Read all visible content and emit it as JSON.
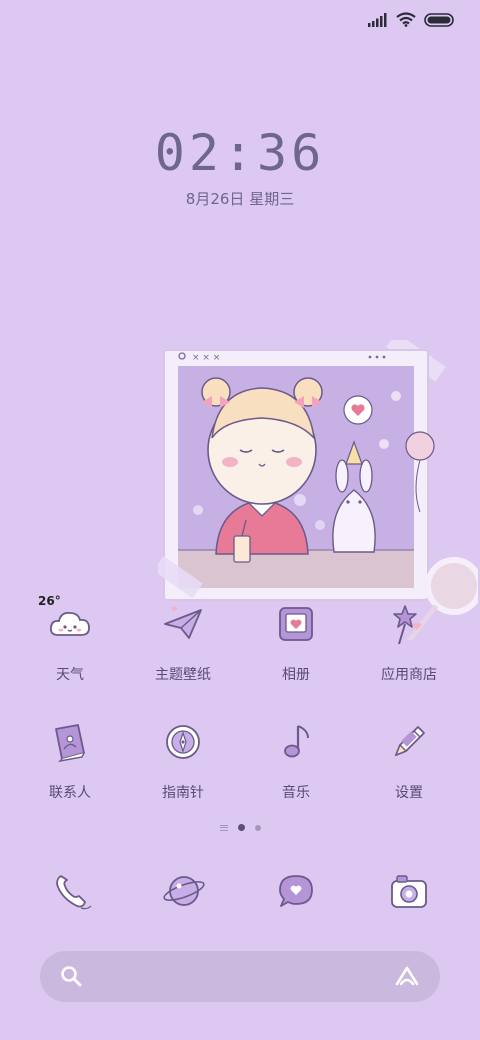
{
  "status_bar": {
    "icons": [
      "signal-icon",
      "wifi-icon",
      "battery-icon"
    ]
  },
  "lock_clock": {
    "time": "02:36",
    "date": "8月26日 星期三"
  },
  "widget": {
    "photo_frame_marks": "○ × × ×",
    "colors": {
      "frame": "#f4eefb",
      "photo_bg": "#c9b3e6",
      "table": "#d9c2cc"
    }
  },
  "weather": {
    "temperature": "26°"
  },
  "apps": {
    "row1": [
      {
        "label": "天气",
        "icon": "cloud-icon"
      },
      {
        "label": "主题壁纸",
        "icon": "paper-plane-icon"
      },
      {
        "label": "相册",
        "icon": "photo-album-icon"
      },
      {
        "label": "应用商店",
        "icon": "star-wand-icon"
      }
    ],
    "row2": [
      {
        "label": "联系人",
        "icon": "contact-book-icon"
      },
      {
        "label": "指南针",
        "icon": "compass-icon"
      },
      {
        "label": "音乐",
        "icon": "music-note-icon"
      },
      {
        "label": "设置",
        "icon": "pencil-icon"
      }
    ]
  },
  "page_indicator": {
    "pages": 3,
    "active": 1
  },
  "dock": [
    {
      "icon": "phone-icon"
    },
    {
      "icon": "planet-icon"
    },
    {
      "icon": "chat-bubble-icon"
    },
    {
      "icon": "camera-icon"
    }
  ],
  "search": {
    "placeholder": ""
  },
  "colors": {
    "background": "#dcc8f0",
    "icon_stroke": "#6b5a8a",
    "icon_fill": "#b79ad8"
  }
}
